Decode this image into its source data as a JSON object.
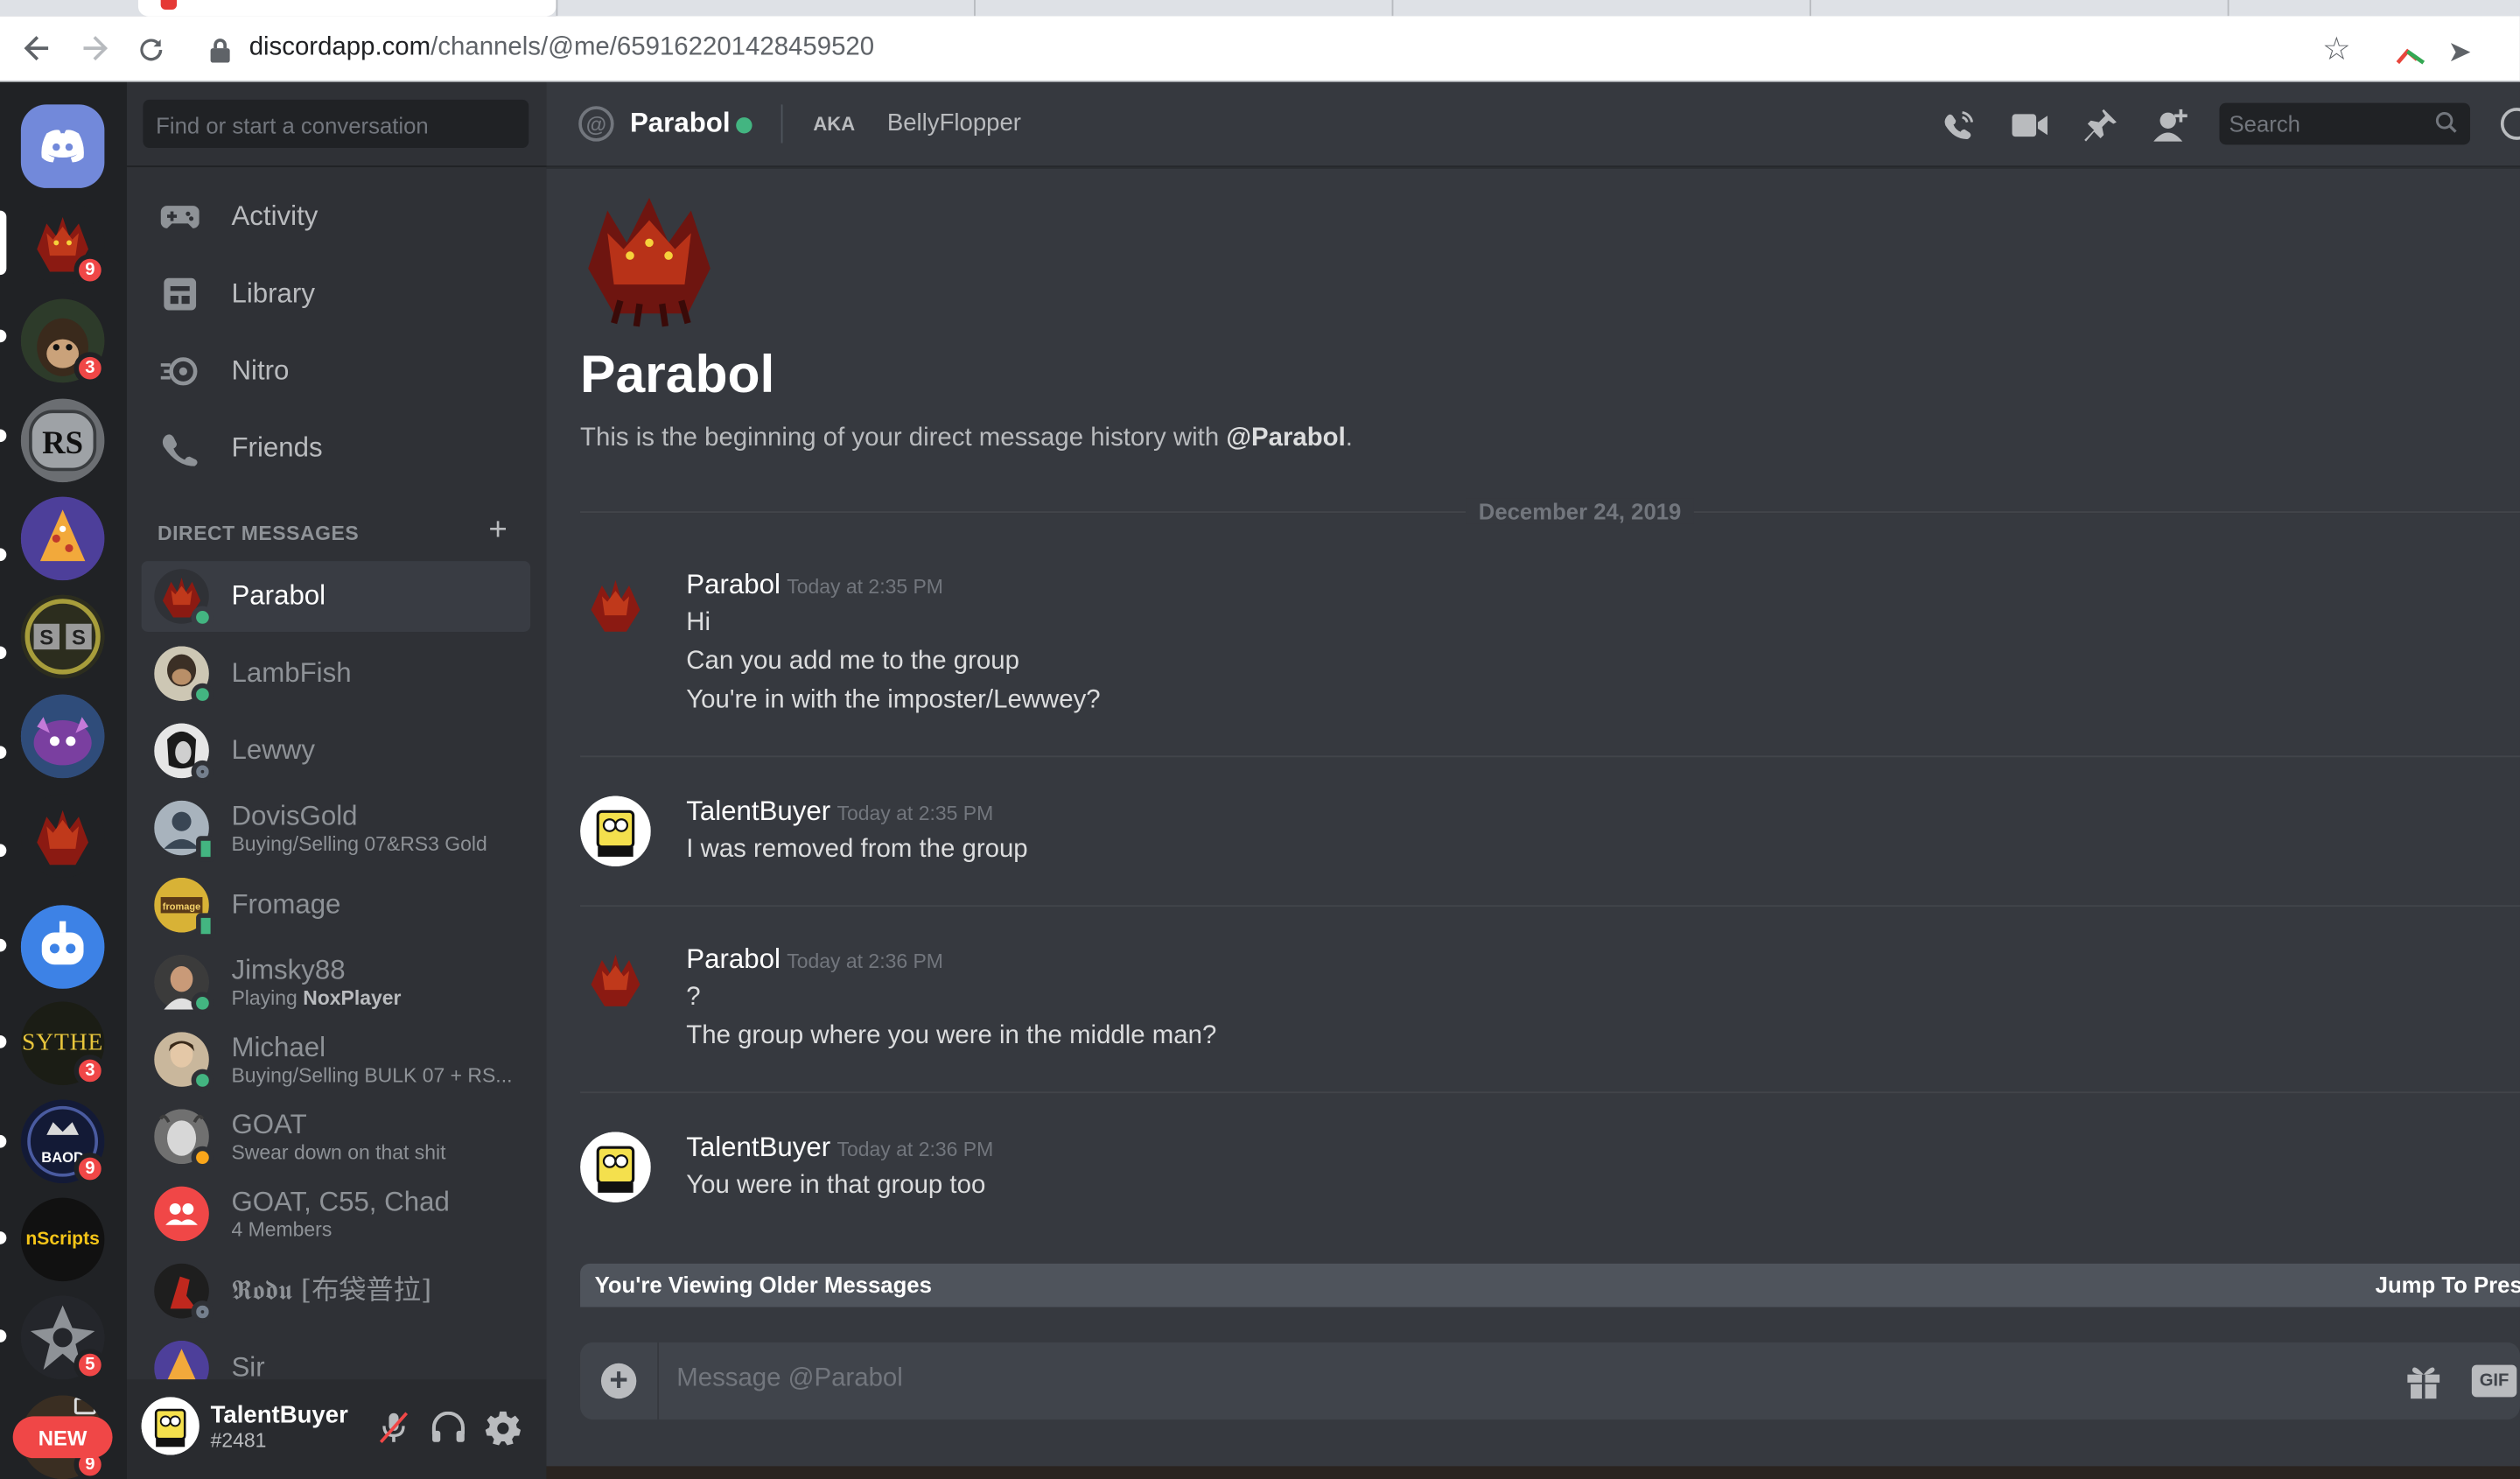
{
  "browser": {
    "url_domain": "discordapp.com",
    "url_path": "/channels/@me/659162201428459520",
    "icons": {
      "back": "arrow-left-icon",
      "forward": "arrow-right-icon",
      "reload": "reload-icon",
      "lock": "lock-icon",
      "bookmark": "star-icon"
    }
  },
  "guilds": [
    {
      "name": "home",
      "badge": ""
    },
    {
      "name": "server-1",
      "badge": "9"
    },
    {
      "name": "server-2",
      "badge": "3"
    },
    {
      "name": "server-rs",
      "badge": ""
    },
    {
      "name": "server-4",
      "badge": ""
    },
    {
      "name": "server-ss",
      "badge": ""
    },
    {
      "name": "server-6",
      "badge": ""
    },
    {
      "name": "server-7",
      "badge": ""
    },
    {
      "name": "server-8",
      "badge": ""
    },
    {
      "name": "sythe",
      "label": "SYTHE",
      "badge": "3"
    },
    {
      "name": "baod",
      "label": "BAOD",
      "badge": "9"
    },
    {
      "name": "nscripts",
      "label": "nScripts",
      "badge": ""
    },
    {
      "name": "server-12",
      "badge": "5"
    },
    {
      "name": "server-13",
      "badge": "9"
    }
  ],
  "new_pill": "NEW",
  "sidebar": {
    "search_placeholder": "Find or start a conversation",
    "nav": [
      {
        "label": "Activity",
        "icon": "gamepad-icon"
      },
      {
        "label": "Library",
        "icon": "library-icon"
      },
      {
        "label": "Nitro",
        "icon": "nitro-icon"
      },
      {
        "label": "Friends",
        "icon": "friends-icon"
      }
    ],
    "dm_header": "DIRECT MESSAGES",
    "dm_add": "+",
    "dms": [
      {
        "name": "Parabol",
        "sub": "",
        "status": "online",
        "active": true
      },
      {
        "name": "LambFish",
        "sub": "",
        "status": "online"
      },
      {
        "name": "Lewwy",
        "sub": "",
        "status": "offline"
      },
      {
        "name": "DovisGold",
        "sub": "Buying/Selling 07&RS3 Gold",
        "status": "mobile"
      },
      {
        "name": "Fromage",
        "sub": "",
        "status": "mobile"
      },
      {
        "name": "Jimsky88",
        "sub_prefix": "Playing ",
        "sub_bold": "NoxPlayer",
        "status": "online"
      },
      {
        "name": "Michael",
        "sub": "Buying/Selling BULK 07 + RS...",
        "status": "online"
      },
      {
        "name": "GOAT",
        "sub": "Swear down on that shit",
        "status": "idle"
      },
      {
        "name": "GOAT, C55, Chad",
        "sub": "4 Members",
        "status": "group"
      },
      {
        "name": "𝕽𝖔𝖉𝖚 [布袋普拉]",
        "sub": "",
        "status": "offline"
      },
      {
        "name": "Sir",
        "sub": "",
        "status": "online"
      }
    ]
  },
  "user": {
    "name": "TalentBuyer",
    "tag": "#2481",
    "icons": [
      "mic-muted-icon",
      "headphones-icon",
      "settings-gear-icon"
    ]
  },
  "chat": {
    "header_name": "Parabol",
    "aka_label": "AKA",
    "aka_name": "BellyFlopper",
    "search_placeholder": "Search",
    "header_icons": [
      "voice-call-icon",
      "video-call-icon",
      "pin-icon",
      "add-member-icon",
      "search-icon"
    ],
    "intro_title": "Parabol",
    "intro_text_before": "This is the beginning of your direct message history with ",
    "intro_text_mention": "@Parabol",
    "intro_text_after": ".",
    "date_divider": "December 24, 2019",
    "messages": [
      {
        "author": "Parabol",
        "timestamp": "Today at 2:35 PM",
        "lines": [
          "Hi",
          "Can you add me to the group",
          "You're in with the imposter/Lewwey?"
        ]
      },
      {
        "author": "TalentBuyer",
        "timestamp": "Today at 2:35 PM",
        "lines": [
          "I was removed from the group"
        ]
      },
      {
        "author": "Parabol",
        "timestamp": "Today at 2:36 PM",
        "lines": [
          "?",
          "The group where you were in the middle man?"
        ]
      },
      {
        "author": "TalentBuyer",
        "timestamp": "Today at 2:36 PM",
        "lines": [
          "You were in that group too"
        ]
      }
    ],
    "older_notice": "You're Viewing Older Messages",
    "jump_label": "Jump To Prese",
    "composer_placeholder": "Message @Parabol",
    "gif_label": "GIF",
    "colors": {
      "online": "#43b581",
      "idle": "#faa61a",
      "offline": "#747f8d",
      "blurple": "#7289da",
      "danger": "#f04747"
    }
  }
}
